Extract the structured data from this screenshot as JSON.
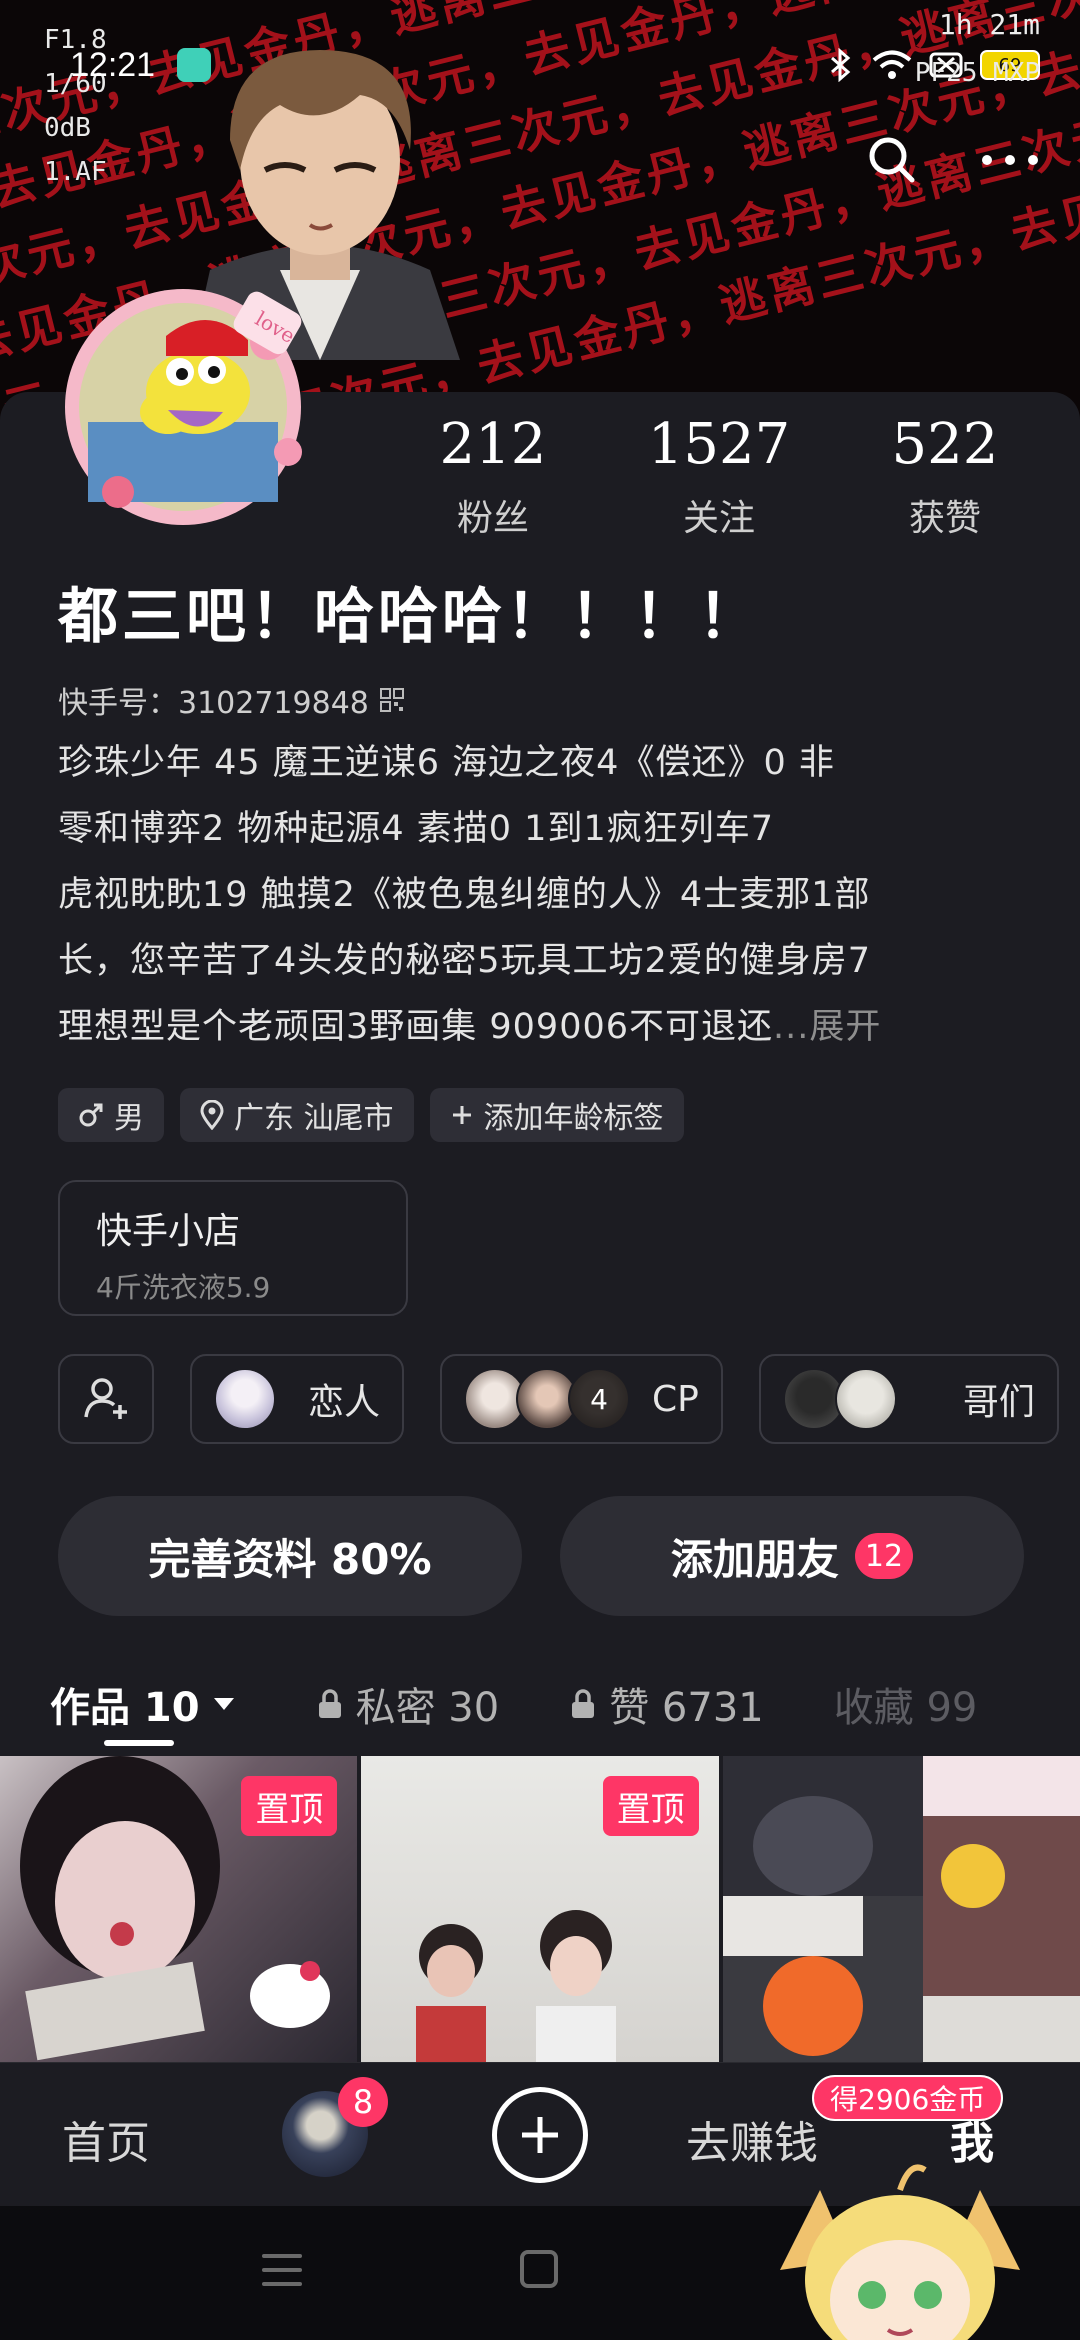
{
  "status_bar": {
    "time": "12:21",
    "battery": "69",
    "remaining": "1h 21m",
    "camera_overlay": [
      "F1.8",
      "1/60",
      "0dB",
      "1.AF"
    ],
    "camera_right": "PF25 MXP"
  },
  "banner": {
    "repeated_text": "逃离三次元，去见金丹"
  },
  "profile": {
    "stats": [
      {
        "value": "212",
        "label": "粉丝"
      },
      {
        "value": "1527",
        "label": "关注"
      },
      {
        "value": "522",
        "label": "获赞"
      }
    ],
    "nickname": "都三吧！哈哈哈！！！！",
    "kwai_id": "快手号：3102719848",
    "bio_lines": [
      "珍珠少年 45  魔王逆谋6 海边之夜4《偿还》0  非",
      "零和博弈2  物种起源4   素描0   1到1疯狂列车7",
      "虎视眈眈19  触摸2《被色鬼纠缠的人》4士麦那1部",
      "长，您辛苦了4头发的秘密5玩具工坊2爱的健身房7",
      "理想型是个老顽固3野画集 909006不可退还"
    ],
    "bio_more": "...展开",
    "tags": {
      "gender": "男",
      "location": "广东 汕尾市",
      "add_age": "添加年龄标签"
    },
    "shop": {
      "title": "快手小店",
      "subtitle": "4斤洗衣液5.9"
    },
    "relations": {
      "lover": "恋人",
      "cp_count": "4",
      "cp": "CP",
      "bros": "哥们"
    },
    "actions": {
      "complete_profile": "完善资料 80%",
      "add_friend": "添加朋友",
      "add_friend_badge": "12"
    }
  },
  "tabs": [
    {
      "label": "作品 10"
    },
    {
      "label": "私密 30"
    },
    {
      "label": "赞 6731"
    },
    {
      "label": "收藏 99"
    }
  ],
  "grid": {
    "pinned_label": "置顶"
  },
  "bottom_nav": {
    "home": "首页",
    "avatar_badge": "8",
    "earn": "去赚钱",
    "coin_pill": "得2906金币",
    "me": "我"
  },
  "colors": {
    "accent": "#fe3666",
    "background": "#1c1c22",
    "banner_text": "#b0121c"
  }
}
